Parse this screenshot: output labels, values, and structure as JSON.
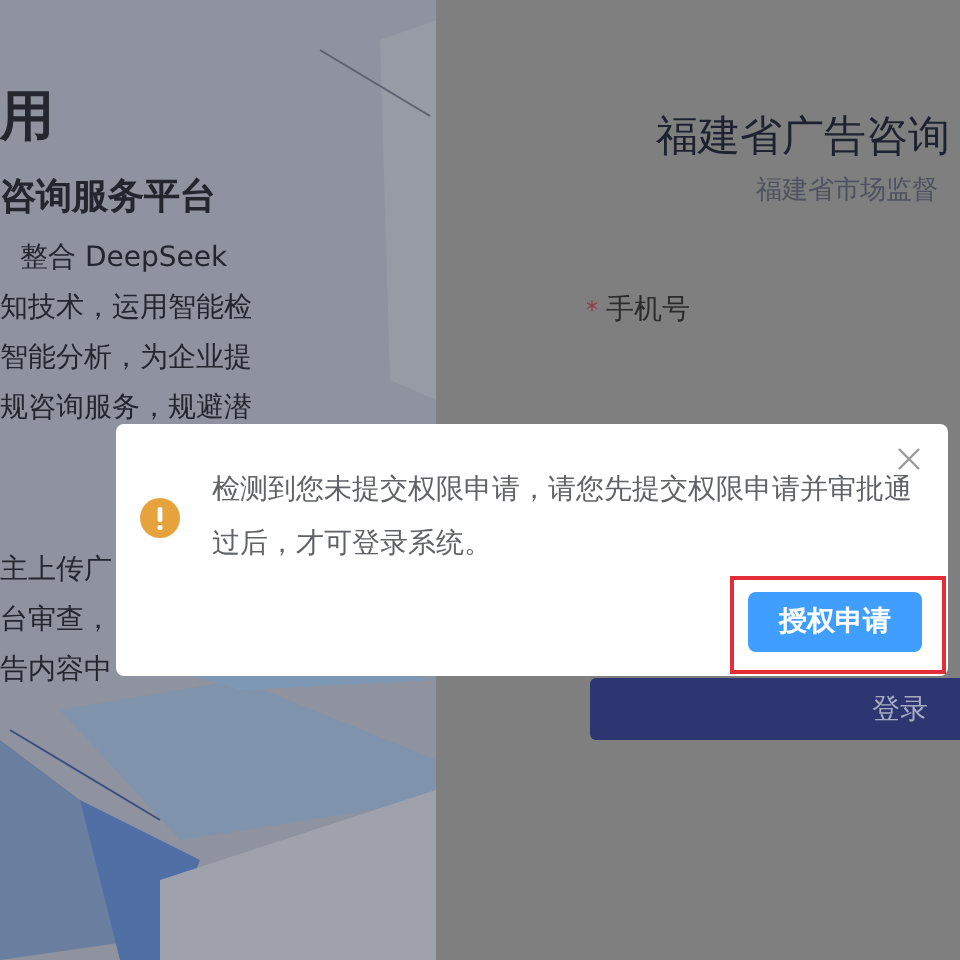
{
  "left_panel": {
    "title_fragment": "用",
    "subtitle": "咨询服务平台",
    "paragraph_lines": [
      "整合 DeepSeek",
      "知技术，运用智能检",
      "智能分析，为企业提",
      "规咨询服务，规避潜"
    ],
    "lower_lines": [
      "主上传广",
      "台审查，",
      "告内容中"
    ]
  },
  "login_panel": {
    "title": "福建省广告咨询",
    "subtitle": "福建省市场监督",
    "phone_field": {
      "required_mark": "*",
      "label": "手机号"
    },
    "login_button": "登录"
  },
  "dialog": {
    "message": "检测到您未提交权限申请，请您先提交权限申请并审批通过后，才可登录系统。",
    "button": "授权申请",
    "highlighted": true
  }
}
